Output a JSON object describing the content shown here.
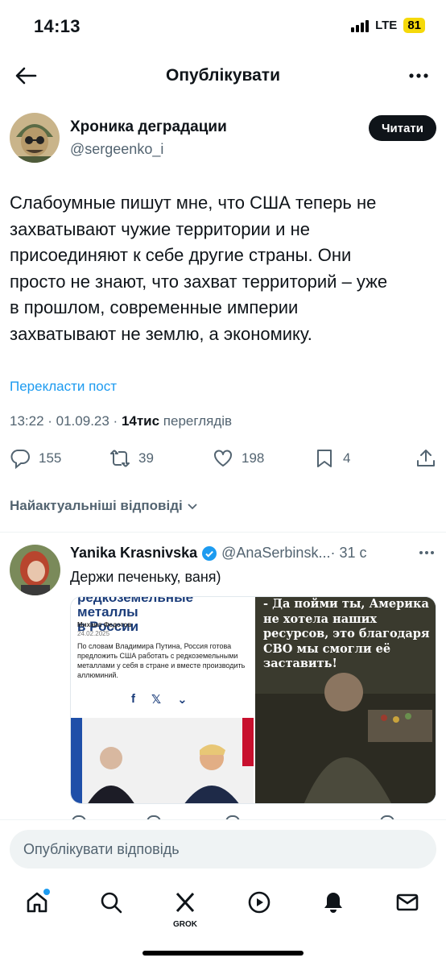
{
  "status": {
    "time": "14:13",
    "network": "LTE",
    "battery": "81"
  },
  "nav": {
    "title": "Опублікувати",
    "back_icon": "arrow-left-icon",
    "more_icon": "more-horizontal-icon"
  },
  "post": {
    "author_name": "Хроника деградации",
    "author_handle": "@sergeenko_i",
    "follow_label": "Читати",
    "text": "Слабоумные пишут мне, что США теперь не\nзахватывают чужие территории и не\nприсоединяют к себе другие страны. Они\nпросто не знают, что захват территорий – уже\nв прошлом, современные империи\nзахватывают не землю, а экономику.",
    "translate_label": "Перекласти пост",
    "timestamp": "13:22 · 01.09.23 · ",
    "views_count": "14тис",
    "views_label": " переглядів",
    "replies": "155",
    "reposts": "39",
    "likes": "198",
    "bookmarks": "4"
  },
  "sort_label": "Найактуальніші відповіді",
  "reply": {
    "name": "Yanika Krasnivska",
    "handle": "@AnaSerbinsk...",
    "time": " · 31 с",
    "text": "Держи печеньку, ваня)",
    "article_title": "редкоземельные металлы\nв России",
    "article_author": "Михаил Федотов",
    "article_date": "24.02.2025",
    "article_body": "По словам Владимира Путина, Россия готова предложить США работать с редкоземельными металлами у себя в стране и вместе производить аллюминий.",
    "meme_text": "- Да пойми ты, Америка не хотела наших ресурсов, это благодаря СВО мы смогли её заставить!"
  },
  "reply_input_placeholder": "Опублікувати відповідь",
  "tabbar": {
    "grok_label": "GROK"
  },
  "colors": {
    "accent": "#1d9bf0",
    "text": "#0f1419",
    "secondary": "#536471",
    "battery": "#f5d90a"
  }
}
